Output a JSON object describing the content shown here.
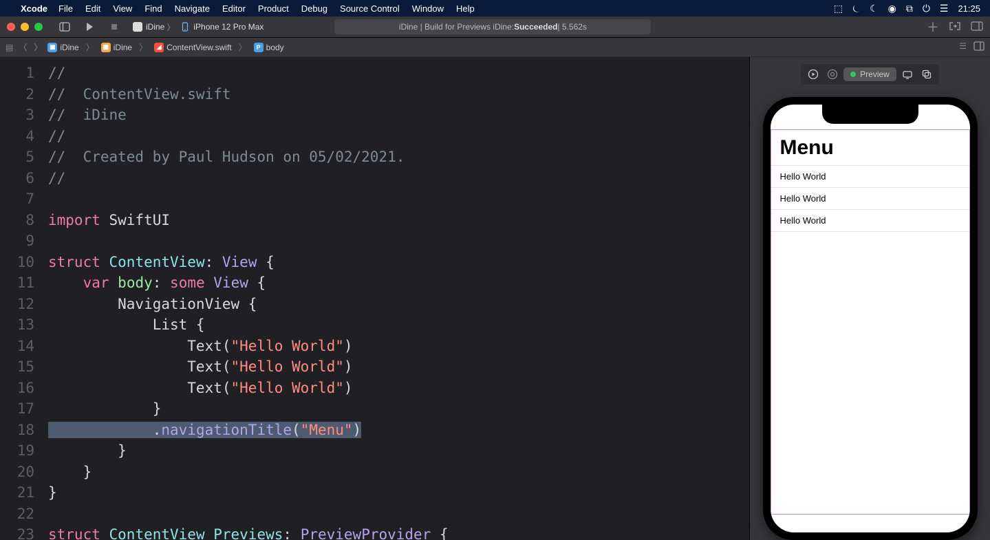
{
  "menubar": {
    "app": "Xcode",
    "items": [
      "File",
      "Edit",
      "View",
      "Find",
      "Navigate",
      "Editor",
      "Product",
      "Debug",
      "Source Control",
      "Window",
      "Help"
    ],
    "clock": "21:25"
  },
  "toolbar": {
    "scheme_target": "iDine",
    "scheme_device": "iPhone 12 Pro Max",
    "status_prefix": "iDine | Build for Previews iDine: ",
    "status_result": "Succeeded",
    "status_time": " | 5.562s"
  },
  "jumpbar": {
    "crumbs": [
      "iDine",
      "iDine",
      "ContentView.swift",
      "body"
    ]
  },
  "code": {
    "lines": [
      {
        "n": "1",
        "seg": [
          {
            "c": "c-comment",
            "t": "//"
          }
        ]
      },
      {
        "n": "2",
        "seg": [
          {
            "c": "c-comment",
            "t": "//  ContentView.swift"
          }
        ]
      },
      {
        "n": "3",
        "seg": [
          {
            "c": "c-comment",
            "t": "//  iDine"
          }
        ]
      },
      {
        "n": "4",
        "seg": [
          {
            "c": "c-comment",
            "t": "//"
          }
        ]
      },
      {
        "n": "5",
        "seg": [
          {
            "c": "c-comment",
            "t": "//  Created by Paul Hudson on 05/02/2021."
          }
        ]
      },
      {
        "n": "6",
        "seg": [
          {
            "c": "c-comment",
            "t": "//"
          }
        ]
      },
      {
        "n": "7",
        "seg": [
          {
            "c": "c-plain",
            "t": ""
          }
        ]
      },
      {
        "n": "8",
        "seg": [
          {
            "c": "c-kw",
            "t": "import"
          },
          {
            "c": "c-plain",
            "t": " SwiftUI"
          }
        ]
      },
      {
        "n": "9",
        "seg": [
          {
            "c": "c-plain",
            "t": ""
          }
        ]
      },
      {
        "n": "10",
        "seg": [
          {
            "c": "c-kw",
            "t": "struct"
          },
          {
            "c": "c-plain",
            "t": " "
          },
          {
            "c": "c-type2",
            "t": "ContentView"
          },
          {
            "c": "c-plain",
            "t": ": "
          },
          {
            "c": "c-type",
            "t": "View"
          },
          {
            "c": "c-plain",
            "t": " {"
          }
        ]
      },
      {
        "n": "11",
        "seg": [
          {
            "c": "c-plain",
            "t": "    "
          },
          {
            "c": "c-kw",
            "t": "var"
          },
          {
            "c": "c-plain",
            "t": " "
          },
          {
            "c": "c-member",
            "t": "body"
          },
          {
            "c": "c-plain",
            "t": ": "
          },
          {
            "c": "c-kw",
            "t": "some"
          },
          {
            "c": "c-plain",
            "t": " "
          },
          {
            "c": "c-type",
            "t": "View"
          },
          {
            "c": "c-plain",
            "t": " {"
          }
        ]
      },
      {
        "n": "12",
        "seg": [
          {
            "c": "c-plain",
            "t": "        NavigationView {"
          }
        ]
      },
      {
        "n": "13",
        "seg": [
          {
            "c": "c-plain",
            "t": "            List {"
          }
        ]
      },
      {
        "n": "14",
        "seg": [
          {
            "c": "c-plain",
            "t": "                Text("
          },
          {
            "c": "c-str",
            "t": "\"Hello World\""
          },
          {
            "c": "c-plain",
            "t": ")"
          }
        ]
      },
      {
        "n": "15",
        "seg": [
          {
            "c": "c-plain",
            "t": "                Text("
          },
          {
            "c": "c-str",
            "t": "\"Hello World\""
          },
          {
            "c": "c-plain",
            "t": ")"
          }
        ]
      },
      {
        "n": "16",
        "seg": [
          {
            "c": "c-plain",
            "t": "                Text("
          },
          {
            "c": "c-str",
            "t": "\"Hello World\""
          },
          {
            "c": "c-plain",
            "t": ")"
          }
        ]
      },
      {
        "n": "17",
        "seg": [
          {
            "c": "c-plain",
            "t": "            }"
          }
        ]
      },
      {
        "n": "18",
        "sel": true,
        "seg": [
          {
            "c": "c-plain",
            "t": "            ."
          },
          {
            "c": "c-type",
            "t": "navigationTitle"
          },
          {
            "c": "c-plain",
            "t": "("
          },
          {
            "c": "c-str",
            "t": "\"Menu\""
          },
          {
            "c": "c-plain",
            "t": ")"
          }
        ]
      },
      {
        "n": "19",
        "seg": [
          {
            "c": "c-plain",
            "t": "        }"
          }
        ]
      },
      {
        "n": "20",
        "seg": [
          {
            "c": "c-plain",
            "t": "    }"
          }
        ]
      },
      {
        "n": "21",
        "seg": [
          {
            "c": "c-plain",
            "t": "}"
          }
        ]
      },
      {
        "n": "22",
        "seg": [
          {
            "c": "c-plain",
            "t": ""
          }
        ]
      },
      {
        "n": "23",
        "seg": [
          {
            "c": "c-kw",
            "t": "struct"
          },
          {
            "c": "c-plain",
            "t": " "
          },
          {
            "c": "c-type2",
            "t": "ContentView_Previews"
          },
          {
            "c": "c-plain",
            "t": ": "
          },
          {
            "c": "c-type",
            "t": "PreviewProvider"
          },
          {
            "c": "c-plain",
            "t": " {"
          }
        ]
      }
    ]
  },
  "canvas": {
    "preview_label": "Preview",
    "nav_title": "Menu",
    "rows": [
      "Hello World",
      "Hello World",
      "Hello World"
    ]
  }
}
